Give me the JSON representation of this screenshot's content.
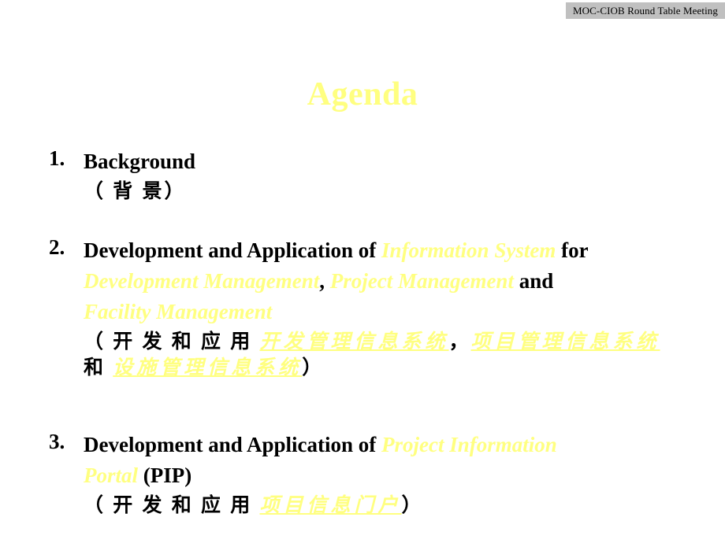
{
  "header": {
    "banner_text": "MOC-CIOB  Round Table Meeting",
    "background_color": "#c0c0c0"
  },
  "slide": {
    "title": "Agenda",
    "title_color": "#ffff80",
    "background_color": "#ffffff",
    "text_color": "#000000"
  },
  "agenda": {
    "items": [
      {
        "number": "1.",
        "english": [
          {
            "segments": [
              {
                "text": "Background",
                "style": "plain"
              }
            ]
          }
        ],
        "chinese": [
          {
            "segments": [
              {
                "text": "（ 背  景）",
                "style": "plain"
              }
            ]
          }
        ]
      },
      {
        "number": "2.",
        "english": [
          {
            "segments": [
              {
                "text": "Development and Application of ",
                "style": "plain"
              },
              {
                "text": "Information System",
                "style": "highlight"
              },
              {
                "text": " for",
                "style": "plain"
              }
            ]
          },
          {
            "segments": [
              {
                "text": "Development Management",
                "style": "highlight"
              },
              {
                "text": ", ",
                "style": "plain"
              },
              {
                "text": "Project Management",
                "style": "highlight"
              },
              {
                "text": " and",
                "style": "plain"
              }
            ]
          },
          {
            "segments": [
              {
                "text": "Facility Management",
                "style": "highlight"
              }
            ]
          }
        ],
        "chinese": [
          {
            "segments": [
              {
                "text": "（ 开 发 和 应 用 ",
                "style": "plain"
              },
              {
                "text": "开发管理信息系统",
                "style": "highlight-underline"
              },
              {
                "text": "，",
                "style": "plain"
              },
              {
                "text": "项目管理信息系统",
                "style": "highlight-underline"
              }
            ]
          },
          {
            "segments": [
              {
                "text": "和 ",
                "style": "plain"
              },
              {
                "text": "设施管理信息系统",
                "style": "highlight-underline"
              },
              {
                "text": "）",
                "style": "plain"
              }
            ]
          }
        ]
      },
      {
        "number": "3.",
        "english": [
          {
            "segments": [
              {
                "text": "Development and Application of ",
                "style": "plain"
              },
              {
                "text": "Project Information",
                "style": "highlight"
              }
            ]
          },
          {
            "segments": [
              {
                "text": "Portal",
                "style": "highlight"
              },
              {
                "text": " (PIP)",
                "style": "plain"
              }
            ]
          }
        ],
        "chinese": [
          {
            "segments": [
              {
                "text": "（ 开 发 和 应 用 ",
                "style": "plain"
              },
              {
                "text": "项目信息门户",
                "style": "highlight-underline"
              },
              {
                "text": "）",
                "style": "plain"
              }
            ]
          }
        ]
      }
    ]
  }
}
